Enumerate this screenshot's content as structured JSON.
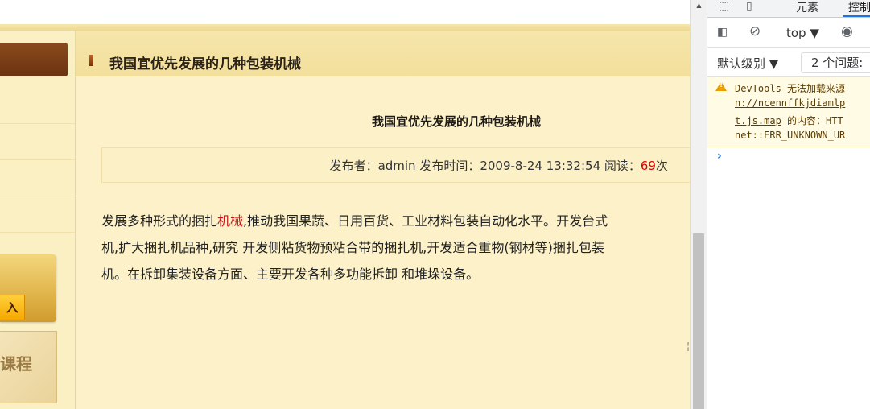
{
  "page": {
    "header_title": "我国宜优先发展的几种包装机械",
    "article_title": "我国宜优先发展的几种包装机械",
    "meta": {
      "publisher_label": "发布者：",
      "publisher": "admin",
      "time_label": " 发布时间：",
      "time": "2009-8-24 13:32:54",
      "read_label": " 阅读：",
      "views": "69",
      "views_unit": "次"
    },
    "body": {
      "line1_a": "发展多种形式的捆扎",
      "keyword": "机械",
      "line1_b": ",推动我国果蔬、日用百货、工业材料包装自动化水平。开发台式",
      "line2": "机,扩大捆扎机品种,研究 开发侧粘货物预粘合带的捆扎机,开发适合重物(钢材等)捆扎包装",
      "line3": "机。在拆卸集装设备方面、主要开发各种多功能拆卸 和堆垛设备。"
    },
    "left": {
      "banner1_button": "入",
      "banner2_text": "课程"
    },
    "side_mark": "¦"
  },
  "devtools": {
    "tabs": {
      "elements": "元素",
      "console": "控制"
    },
    "toolbar": {
      "context": "top ▼"
    },
    "filter": {
      "level": "默认级别 ▼",
      "issues": "2 个问题:"
    },
    "warning": {
      "line1": "DevTools 无法加载来源",
      "line2": "n://ncennffkjdiamlp",
      "line3_link": "t.js.map",
      "line3_rest": " 的内容：HTT",
      "line4": "net::ERR_UNKNOWN_UR"
    },
    "prompt": "›"
  },
  "colors": {
    "accent": "#c4161c",
    "views_color": "#e00000",
    "devtools_link": "#1a73e8",
    "warning_bg": "#fffbe5"
  }
}
